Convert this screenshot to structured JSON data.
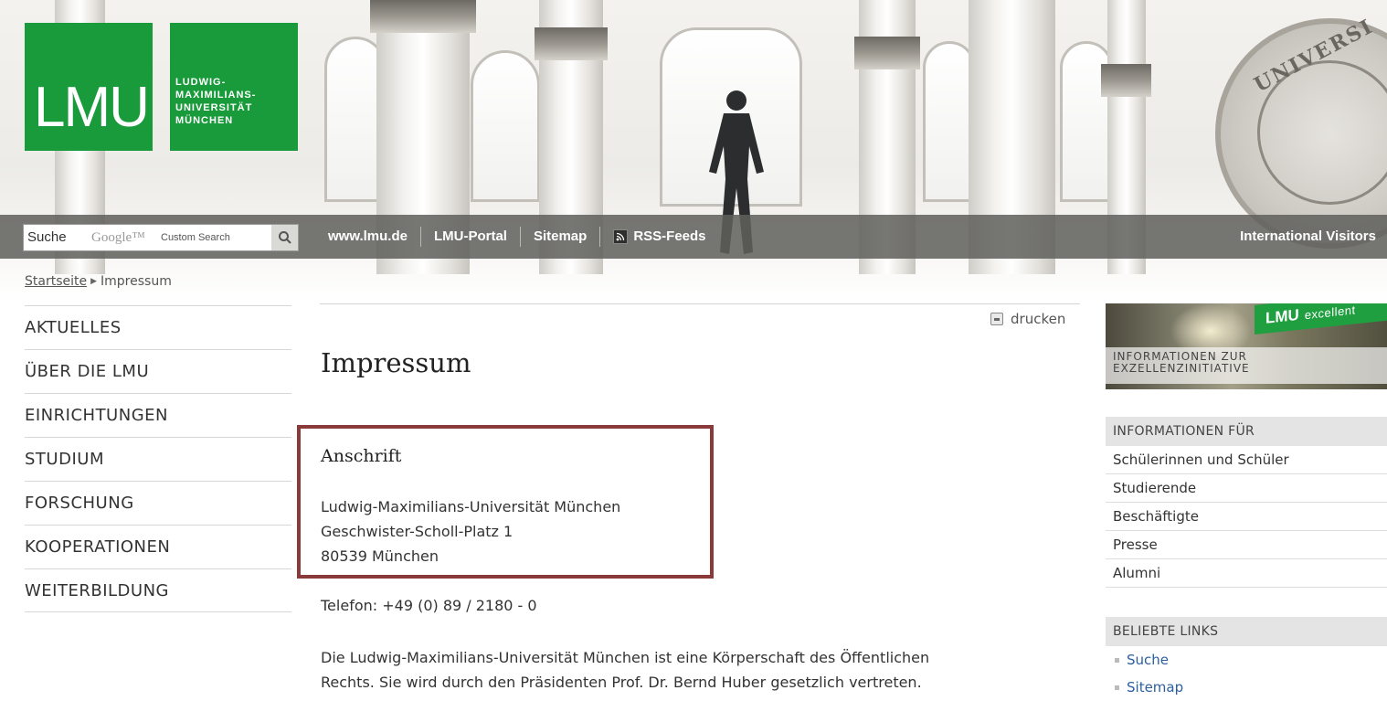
{
  "header": {
    "logo_text": "LMU",
    "university_name": "LUDWIG-\nMAXIMILIANS-\nUNIVERSITÄT\nMÜNCHEN",
    "seal_text": "UNIVERSI"
  },
  "navbar": {
    "search_label": "Suche",
    "search_brand": "Google™",
    "search_sub": "Custom Search",
    "links": [
      "www.lmu.de",
      "LMU-Portal",
      "Sitemap",
      "RSS-Feeds"
    ],
    "international": "International Visitors"
  },
  "breadcrumb": {
    "home": "Startseite",
    "current": "Impressum"
  },
  "leftnav": {
    "items": [
      "AKTUELLES",
      "ÜBER DIE LMU",
      "EINRICHTUNGEN",
      "STUDIUM",
      "FORSCHUNG",
      "KOOPERATIONEN",
      "WEITERBILDUNG"
    ]
  },
  "main": {
    "print_label": "drucken",
    "title": "Impressum",
    "address_heading": "Anschrift",
    "address_lines": [
      "Ludwig-Maximilians-Universität München",
      "Geschwister-Scholl-Platz 1",
      "80539 München"
    ],
    "phone": "Telefon: +49 (0) 89 / 2180 - 0",
    "legal_lines": [
      "Die Ludwig-Maximilians-Universität München ist eine Körperschaft des Öffentlichen",
      "Rechts. Sie wird durch den Präsidenten Prof. Dr. Bernd Huber gesetzlich vertreten."
    ]
  },
  "sidebar": {
    "excellent_logo": "LMU",
    "excellent_word": "excellent",
    "excellent_caption": "INFORMATIONEN ZUR\nEXZELLENZINITIATIVE",
    "info_heading": "INFORMATIONEN FÜR",
    "info_items": [
      "Schülerinnen und Schüler",
      "Studierende",
      "Beschäftigte",
      "Presse",
      "Alumni"
    ],
    "links_heading": "BELIEBTE LINKS",
    "links": [
      "Suche",
      "Sitemap"
    ]
  },
  "colors": {
    "lmu_green": "#199b3b",
    "highlight_border": "#8b3a3a",
    "link_blue": "#2c5f9f"
  }
}
